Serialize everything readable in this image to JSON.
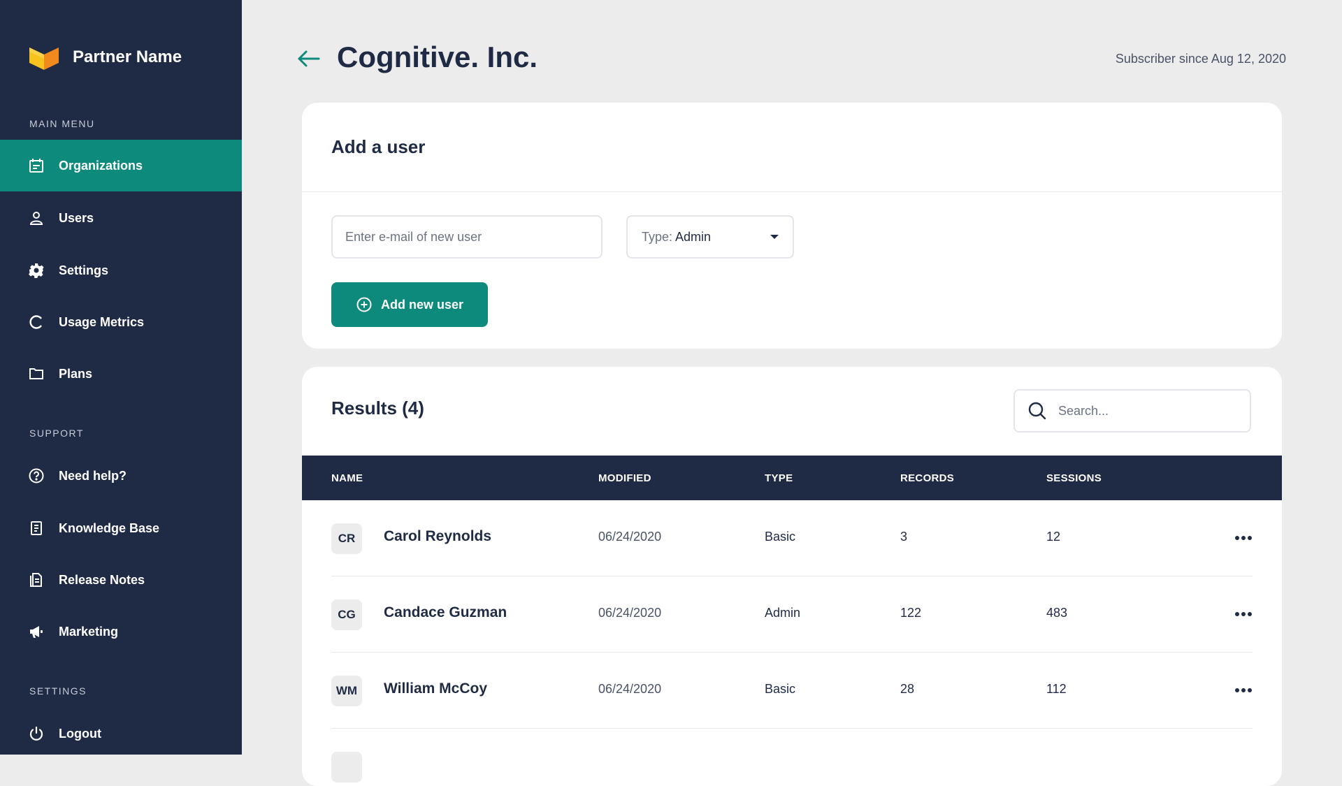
{
  "sidebar": {
    "brand_name": "Partner Name",
    "sections": {
      "main_menu": "MAIN MENU",
      "support": "SUPPORT",
      "settings": "SETTINGS"
    },
    "items": {
      "organizations": "Organizations",
      "users": "Users",
      "settings": "Settings",
      "usage_metrics": "Usage Metrics",
      "plans": "Plans",
      "need_help": "Need help?",
      "knowledge_base": "Knowledge Base",
      "release_notes": "Release Notes",
      "marketing": "Marketing",
      "logout": "Logout"
    },
    "active_item": "Organizations"
  },
  "header": {
    "title": "Cognitive. Inc.",
    "subscriber_text": "Subscriber since Aug 12, 2020"
  },
  "add_user": {
    "title": "Add a user",
    "email_placeholder": "Enter e-mail of new user",
    "email_value": "",
    "type_prefix": "Type:",
    "type_value": "Admin",
    "button_label": "Add new user"
  },
  "results": {
    "title": "Results (4)",
    "search_placeholder": "Search...",
    "columns": {
      "name": "NAME",
      "modified": "MODIFIED",
      "type": "TYPE",
      "records": "RECORDS",
      "sessions": "SESSIONS"
    },
    "rows": [
      {
        "initials": "CR",
        "name": "Carol Reynolds",
        "modified": "06/24/2020",
        "type": "Basic",
        "records": "3",
        "sessions": "12"
      },
      {
        "initials": "CG",
        "name": "Candace Guzman",
        "modified": "06/24/2020",
        "type": "Admin",
        "records": "122",
        "sessions": "483"
      },
      {
        "initials": "WM",
        "name": "William McCoy",
        "modified": "06/24/2020",
        "type": "Basic",
        "records": "28",
        "sessions": "112"
      }
    ]
  },
  "colors": {
    "sidebar_bg": "#1f2a44",
    "accent": "#0e8a7d",
    "page_bg": "#ececec",
    "logo_yellow": "#f7c31c",
    "logo_orange": "#f08a1c"
  },
  "icons": {
    "organizations": "calendar-icon",
    "users": "user-icon",
    "settings": "gear-icon",
    "usage_metrics": "refresh-icon",
    "plans": "folder-icon",
    "need_help": "help-circle-icon",
    "knowledge_base": "book-icon",
    "release_notes": "notes-icon",
    "marketing": "megaphone-icon",
    "logout": "power-icon"
  }
}
